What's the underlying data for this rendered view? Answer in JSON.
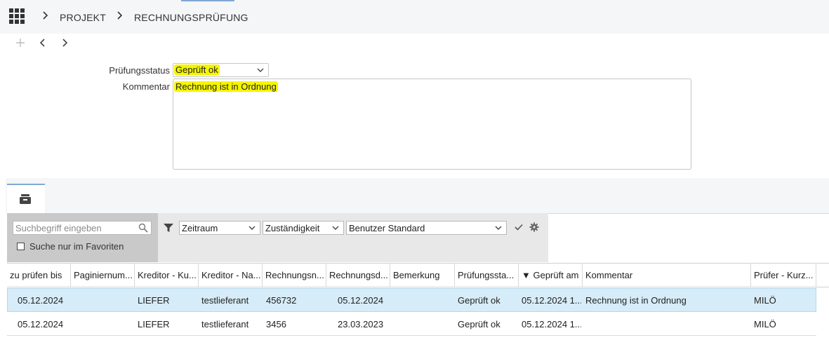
{
  "breadcrumb": {
    "items": [
      "PROJEKT",
      "RECHNUNGSPRÜFUNG"
    ]
  },
  "form": {
    "status_label": "Prüfungsstatus",
    "status_value": "Geprüft ok",
    "comment_label": "Kommentar",
    "comment_value": "Rechnung ist in Ordnung"
  },
  "filter": {
    "search_placeholder": "Suchbegriff eingeben",
    "favorites_label": "Suche nur im Favoriten",
    "zeitraum": "Zeitraum",
    "zustaendigkeit": "Zuständigkeit",
    "view": "Benutzer Standard"
  },
  "table": {
    "columns": [
      "zu prüfen bis",
      "Paginiernum...",
      "Kreditor - Ku...",
      "Kreditor - Na...",
      "Rechnungsn...",
      "Rechnungsd...",
      "Bemerkung",
      "Prüfungssta...",
      "▼ Geprüft am",
      "Kommentar",
      "Prüfer - Kurz..."
    ],
    "rows": [
      [
        "05.12.2024",
        "",
        "LIEFER",
        "testlieferant",
        "456732",
        "05.12.2024",
        "",
        "Geprüft ok",
        "05.12.2024 1...",
        "Rechnung ist in Ordnung",
        "MILÖ"
      ],
      [
        "05.12.2024",
        "",
        "LIEFER",
        "testlieferant",
        "3456",
        "23.03.2023",
        "",
        "Geprüft ok",
        "05.12.2024 1...",
        "",
        "MILÖ"
      ]
    ]
  },
  "colors": {
    "highlight": "#f5f500",
    "selected_row": "#d6ecf8",
    "accent": "#7fa8d4"
  },
  "icons": [
    "apps-grid-icon",
    "chevron-right-icon",
    "plus-icon",
    "back-icon",
    "forward-icon",
    "chevron-down-icon",
    "archive-icon",
    "search-icon",
    "funnel-icon",
    "check-icon",
    "gear-icon"
  ]
}
